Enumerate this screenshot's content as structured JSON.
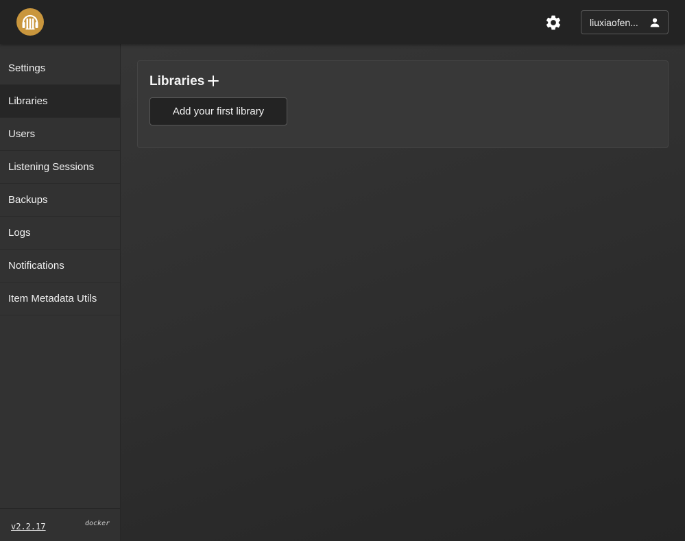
{
  "header": {
    "logo_icon": "audiobookshelf-logo-icon",
    "settings_icon": "gear-icon",
    "user": {
      "name": "liuxiaofen...",
      "icon": "user-icon"
    }
  },
  "sidebar": {
    "items": [
      {
        "label": "Settings",
        "active": false
      },
      {
        "label": "Libraries",
        "active": true
      },
      {
        "label": "Users",
        "active": false
      },
      {
        "label": "Listening Sessions",
        "active": false
      },
      {
        "label": "Backups",
        "active": false
      },
      {
        "label": "Logs",
        "active": false
      },
      {
        "label": "Notifications",
        "active": false
      },
      {
        "label": "Item Metadata Utils",
        "active": false
      }
    ],
    "footer": {
      "version": "v2.2.17",
      "environment": "docker"
    }
  },
  "main": {
    "libraries_card": {
      "title": "Libraries",
      "add_icon": "plus-icon",
      "add_first_label": "Add your first library"
    }
  },
  "colors": {
    "accent_logo": "#c9963d",
    "topbar_bg": "#232323",
    "sidebar_bg": "#323232",
    "card_bg": "#383838"
  }
}
